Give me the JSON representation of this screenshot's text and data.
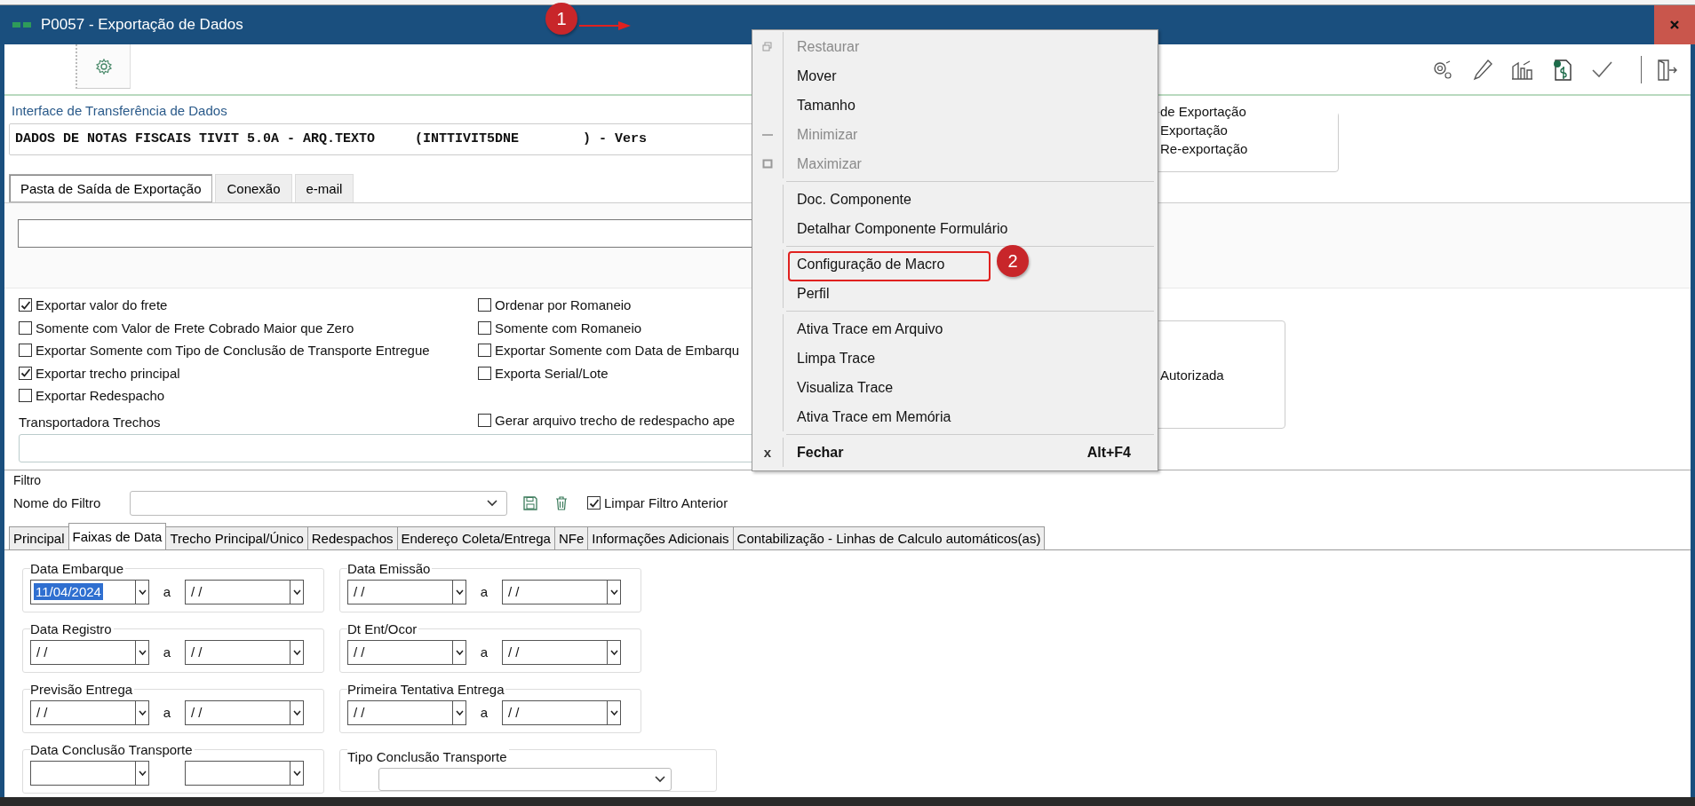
{
  "window": {
    "title": "P0057 - Exportação de Dados"
  },
  "interface": {
    "label": "Interface de Transferência de Dados",
    "value": "DADOS DE NOTAS FISCAIS TIVIT 5.0A - ARQ.TEXTO     (INTTIVIT5DNE        ) - Vers"
  },
  "export_group": {
    "title": "de Exportação",
    "options": [
      "Exportação",
      "Re-exportação"
    ]
  },
  "output_tabs": [
    {
      "label": "Pasta de Saída de Exportação",
      "selected": true
    },
    {
      "label": "Conexão",
      "selected": false
    },
    {
      "label": "e-mail",
      "selected": false
    }
  ],
  "options_left": [
    {
      "label": "Exportar valor do frete",
      "checked": true
    },
    {
      "label": "Somente com Valor de Frete Cobrado Maior que Zero",
      "checked": false
    },
    {
      "label": "Exportar Somente com Tipo de Conclusão de Transporte Entregue",
      "checked": false
    },
    {
      "label": "Exportar trecho principal",
      "checked": true
    },
    {
      "label": "Exportar Redespacho",
      "checked": false
    }
  ],
  "options_right": [
    {
      "label": "Ordenar por Romaneio",
      "checked": false
    },
    {
      "label": "Somente com Romaneio",
      "checked": false
    },
    {
      "label": "Exportar Somente com Data de Embarqu",
      "checked": false
    },
    {
      "label": "Exporta Serial/Lote",
      "checked": false
    }
  ],
  "redispatch_option": {
    "label": "Gerar arquivo trecho de redespacho ape",
    "checked": false
  },
  "carriers": {
    "label": "Transportadora Trechos"
  },
  "status_group": {
    "option": "Autorizada"
  },
  "filter": {
    "title": "Filtro",
    "name_label": "Nome do Filtro",
    "clear_previous": {
      "label": "Limpar Filtro Anterior",
      "checked": true
    }
  },
  "filter_tabs": [
    {
      "label": "Principal",
      "selected": false
    },
    {
      "label": "Faixas de Data",
      "selected": true
    },
    {
      "label": "Trecho Principal/Único",
      "selected": false
    },
    {
      "label": "Redespachos",
      "selected": false
    },
    {
      "label": "Endereço Coleta/Entrega",
      "selected": false
    },
    {
      "label": "NFe",
      "selected": false
    },
    {
      "label": "Informações Adicionais",
      "selected": false
    },
    {
      "label": "Contabilização - Linhas de Calculo automáticos(as)",
      "selected": false
    }
  ],
  "date_ranges": [
    {
      "kind": "range",
      "label": "Data Embarque",
      "between": "a",
      "from": "11/04/2024",
      "to": "/ /",
      "from_selected": true
    },
    {
      "kind": "range",
      "label": "Data Emissão",
      "between": "a",
      "from": "/ /",
      "to": "/ /",
      "from_selected": false
    },
    {
      "kind": "range",
      "label": "Data Registro",
      "between": "a",
      "from": "/ /",
      "to": "/ /",
      "from_selected": false
    },
    {
      "kind": "range",
      "label": "Dt Ent/Ocor",
      "between": "a",
      "from": "/ /",
      "to": "/ /",
      "from_selected": false
    },
    {
      "kind": "range",
      "label": "Previsão Entrega",
      "between": "a",
      "from": "/ /",
      "to": "/ /",
      "from_selected": false
    },
    {
      "kind": "range",
      "label": "Primeira Tentativa Entrega",
      "between": "a",
      "from": "/ /",
      "to": "/ /",
      "from_selected": false
    },
    {
      "kind": "range",
      "label": "Data Conclusão Transporte"
    },
    {
      "kind": "combo",
      "label": "Tipo Conclusão Transporte"
    }
  ],
  "context_menu": {
    "items": [
      {
        "kind": "restore",
        "label": "Restaurar",
        "disabled": true
      },
      {
        "kind": "item",
        "label": "Mover",
        "disabled": false
      },
      {
        "kind": "item",
        "label": "Tamanho",
        "disabled": false
      },
      {
        "kind": "minimize",
        "label": "Minimizar",
        "disabled": true
      },
      {
        "kind": "maximize",
        "label": "Maximizar",
        "disabled": true
      },
      {
        "kind": "separator"
      },
      {
        "kind": "item",
        "label": "Doc. Componente",
        "disabled": false
      },
      {
        "kind": "item",
        "label": "Detalhar Componente Formulário",
        "disabled": false
      },
      {
        "kind": "separator"
      },
      {
        "kind": "item",
        "label": "Configuração de Macro",
        "disabled": false,
        "highlighted": true
      },
      {
        "kind": "item",
        "label": "Perfil",
        "disabled": false
      },
      {
        "kind": "separator"
      },
      {
        "kind": "item",
        "label": "Ativa Trace em Arquivo",
        "disabled": false
      },
      {
        "kind": "item",
        "label": "Limpa Trace",
        "disabled": false
      },
      {
        "kind": "item",
        "label": "Visualiza Trace",
        "disabled": false
      },
      {
        "kind": "item",
        "label": "Ativa Trace em Memória",
        "disabled": false
      },
      {
        "kind": "separator"
      },
      {
        "kind": "default",
        "label": "Fechar",
        "disabled": false,
        "shortcut": "Alt+F4",
        "glyph": "x"
      }
    ]
  },
  "annotations": [
    {
      "kind": "arrow",
      "number": "1"
    },
    {
      "kind": "badge",
      "number": "2"
    }
  ]
}
